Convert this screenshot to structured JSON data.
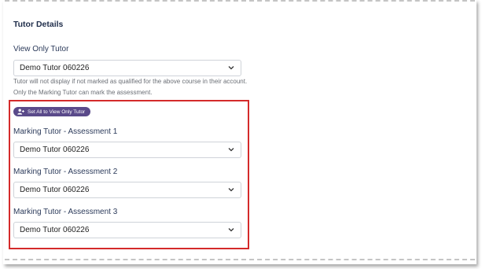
{
  "section": {
    "title": "Tutor Details"
  },
  "view_only": {
    "label": "View Only Tutor",
    "value": "Demo Tutor 060226",
    "help_line1": "Tutor will not display if not marked as qualified for the above course in their account.",
    "help_line2": "Only the Marking Tutor can mark the assessment."
  },
  "set_all_button": {
    "label": "Set All to View Only Tutor",
    "icon": "user-plus-icon"
  },
  "marking_tutors": [
    {
      "label": "Marking Tutor - Assessment 1",
      "value": "Demo Tutor 060226"
    },
    {
      "label": "Marking Tutor - Assessment 2",
      "value": "Demo Tutor 060226"
    },
    {
      "label": "Marking Tutor - Assessment 3",
      "value": "Demo Tutor 060226"
    }
  ],
  "colors": {
    "highlight_border": "#d42a2a",
    "button_bg": "#5a4a8a",
    "title_text": "#1f2d4a"
  }
}
